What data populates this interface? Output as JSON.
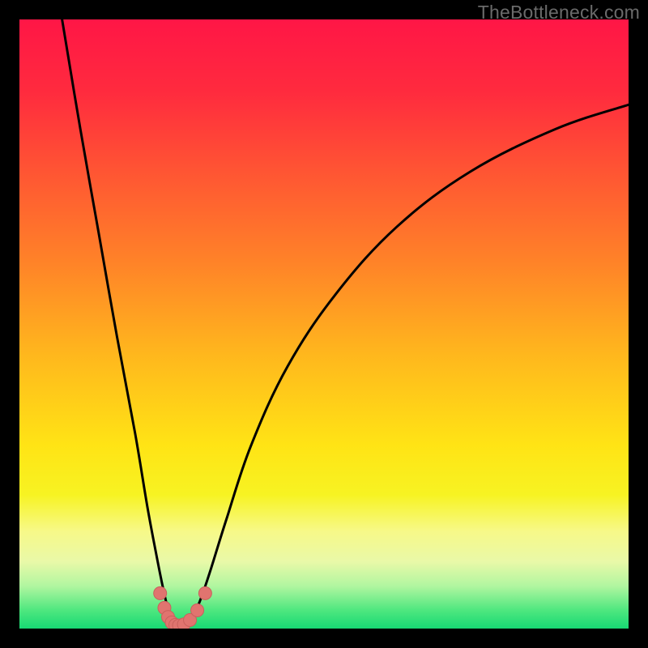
{
  "watermark": "TheBottleneck.com",
  "colors": {
    "gradient_stops": [
      {
        "offset": 0.0,
        "color": "#ff1646"
      },
      {
        "offset": 0.12,
        "color": "#ff2b3e"
      },
      {
        "offset": 0.25,
        "color": "#ff5533"
      },
      {
        "offset": 0.4,
        "color": "#ff8328"
      },
      {
        "offset": 0.55,
        "color": "#ffb71d"
      },
      {
        "offset": 0.7,
        "color": "#ffe415"
      },
      {
        "offset": 0.78,
        "color": "#f7f322"
      },
      {
        "offset": 0.84,
        "color": "#f7f988"
      },
      {
        "offset": 0.89,
        "color": "#e9f9a8"
      },
      {
        "offset": 0.93,
        "color": "#b1f6a0"
      },
      {
        "offset": 0.97,
        "color": "#4ee77f"
      },
      {
        "offset": 1.0,
        "color": "#17d873"
      }
    ],
    "curve": "#000000",
    "marker_fill": "#e0746f",
    "marker_stroke": "#c9605c"
  },
  "chart_data": {
    "type": "line",
    "title": "",
    "xlabel": "",
    "ylabel": "",
    "xlim": [
      0,
      100
    ],
    "ylim": [
      0,
      100
    ],
    "grid": false,
    "series": [
      {
        "name": "left-branch",
        "x": [
          7,
          10,
          13,
          16,
          19,
          21,
          22.5,
          23.5,
          24.3,
          25.0,
          25.5
        ],
        "y": [
          100,
          82,
          65,
          48,
          32,
          20,
          12,
          7,
          3.5,
          1.3,
          0.7
        ]
      },
      {
        "name": "right-branch",
        "x": [
          27.5,
          28.3,
          29.0,
          30.0,
          31.5,
          34,
          38,
          44,
          52,
          62,
          74,
          88,
          100
        ],
        "y": [
          0.7,
          1.5,
          3.0,
          5.5,
          10,
          18,
          30,
          43,
          55,
          66,
          75,
          82,
          86
        ]
      }
    ],
    "markers": {
      "name": "valley-markers",
      "x": [
        23.1,
        23.8,
        24.4,
        25.0,
        25.6,
        26.2,
        27.0,
        28.0,
        29.2,
        30.5
      ],
      "y": [
        5.8,
        3.4,
        1.9,
        1.0,
        0.6,
        0.5,
        0.7,
        1.4,
        3.0,
        5.8
      ]
    }
  }
}
